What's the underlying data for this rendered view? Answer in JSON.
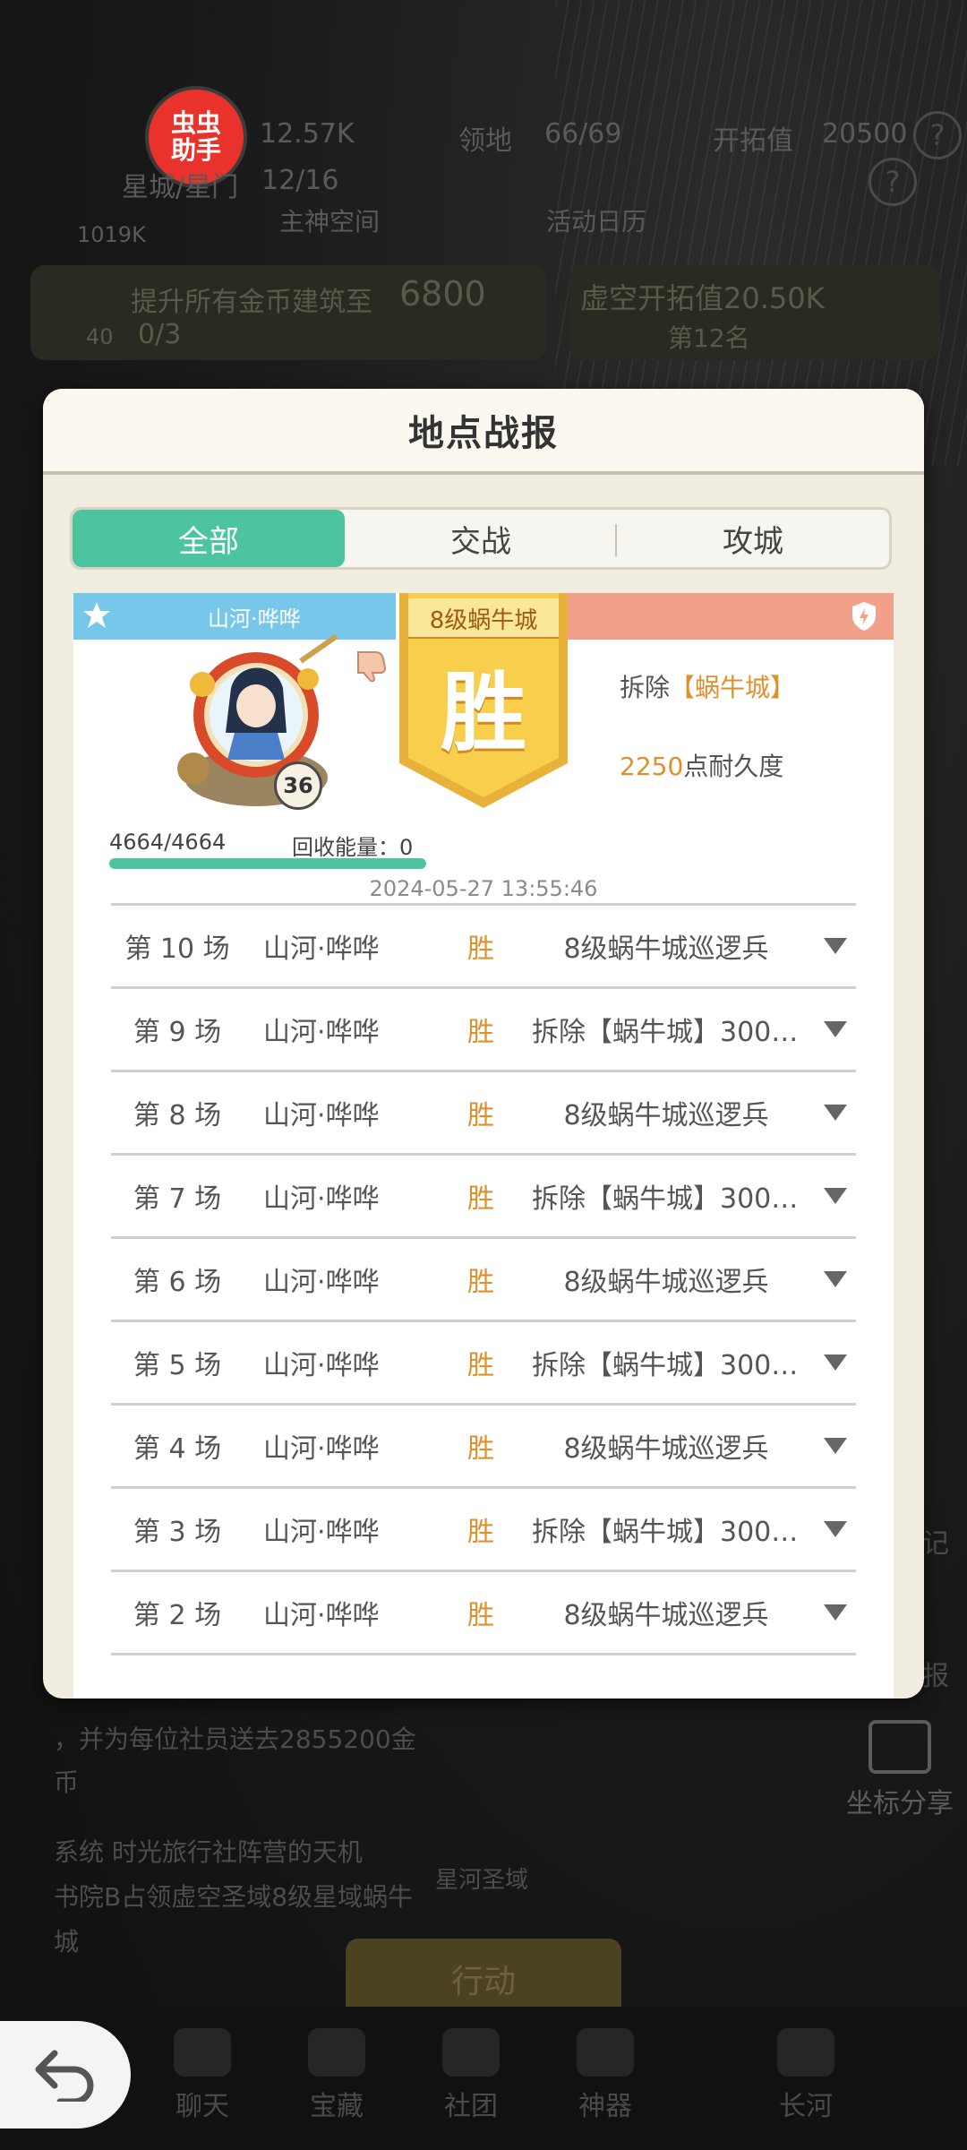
{
  "background": {
    "helper_badge": "虫虫\n助手",
    "top_stats": [
      {
        "label": "12.57K"
      },
      {
        "label": "领地"
      },
      {
        "label": "66/69"
      },
      {
        "label": "开拓值"
      },
      {
        "label": "20500"
      }
    ],
    "star_gate": "星城/星门",
    "star_gate_count": "12/16",
    "power": "1019K",
    "top_links": [
      "主神空间",
      "活动日历"
    ],
    "task_left": "提升所有金币建筑至",
    "task_left_value": "6800",
    "task_left_count": "0/3",
    "task_left_num": "40",
    "task_right": "虚空开拓值20.50K",
    "task_right_rank": "第12名",
    "chat_line1": "，并为每位社员送去2855200金",
    "chat_line2": "币",
    "chat_line3": "系统  时光旅行社阵营的天机",
    "chat_line4": "书院B占领虚空圣域8级星域蜗牛",
    "chat_line5": "城",
    "side_labels": [
      "记",
      "报"
    ],
    "share_label": "坐标分享",
    "action_button": "行动",
    "tower_label": "星河圣域",
    "nav": [
      "聊天",
      "宝藏",
      "社团",
      "神器",
      "长河"
    ]
  },
  "dialog": {
    "title": "地点战报",
    "tabs": [
      {
        "label": "全部",
        "active": true
      },
      {
        "label": "交战",
        "active": false
      },
      {
        "label": "攻城",
        "active": false
      }
    ],
    "summary": {
      "attacker": "山河·哗哗",
      "level": "36",
      "banner_subtitle": "8级蜗牛城",
      "banner_result": "胜",
      "action_prefix": "拆除",
      "action_target": "【蜗牛城】",
      "durability_value": "2250",
      "durability_label": "点耐久度",
      "hp": "4664/4664",
      "hp_fraction": 1.0,
      "energy_label": "回收能量：",
      "energy_value": "0",
      "timestamp": "2024-05-27 13:55:46"
    },
    "battles": [
      {
        "round": "第 10 场",
        "who": "山河·哗哗",
        "result": "胜",
        "desc": "8级蜗牛城巡逻兵"
      },
      {
        "round": "第 9 场",
        "who": "山河·哗哗",
        "result": "胜",
        "desc": "拆除【蜗牛城】300 ..."
      },
      {
        "round": "第 8 场",
        "who": "山河·哗哗",
        "result": "胜",
        "desc": "8级蜗牛城巡逻兵"
      },
      {
        "round": "第 7 场",
        "who": "山河·哗哗",
        "result": "胜",
        "desc": "拆除【蜗牛城】300 ..."
      },
      {
        "round": "第 6 场",
        "who": "山河·哗哗",
        "result": "胜",
        "desc": "8级蜗牛城巡逻兵"
      },
      {
        "round": "第 5 场",
        "who": "山河·哗哗",
        "result": "胜",
        "desc": "拆除【蜗牛城】300 ..."
      },
      {
        "round": "第 4 场",
        "who": "山河·哗哗",
        "result": "胜",
        "desc": "8级蜗牛城巡逻兵"
      },
      {
        "round": "第 3 场",
        "who": "山河·哗哗",
        "result": "胜",
        "desc": "拆除【蜗牛城】300 ..."
      },
      {
        "round": "第 2 场",
        "who": "山河·哗哗",
        "result": "胜",
        "desc": "8级蜗牛城巡逻兵"
      }
    ]
  },
  "colors": {
    "accent_green": "#4cc49f",
    "win_orange": "#e0902a",
    "banner_gold": "#f5c542",
    "attacker_blue": "#76c7ea",
    "defender_salmon": "#f1a08a"
  }
}
